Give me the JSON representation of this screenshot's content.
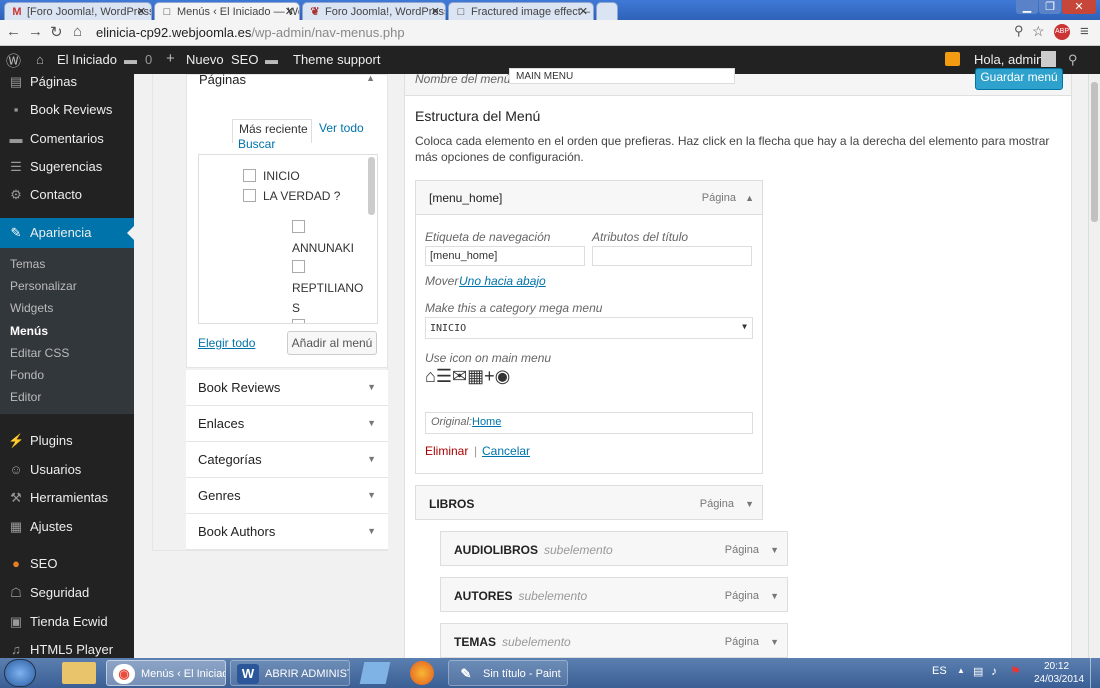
{
  "browser": {
    "tabs": [
      {
        "icon": "M",
        "title": "[Foro Joomla!, WordPress"
      },
      {
        "icon": "□",
        "title": "Menús ‹ El Iniciado — Wo"
      },
      {
        "icon": "❦",
        "title": "Foro Joomla!, WordPress y"
      },
      {
        "icon": "□",
        "title": "Fractured image effect – F"
      }
    ],
    "url_host": "elinicia-cp92.webjoomla.es",
    "url_path": "/wp-admin/nav-menus.php"
  },
  "adminbar": {
    "site": "El Iniciado",
    "comments": "0",
    "new": "Nuevo",
    "seo": "SEO",
    "theme_support": "Theme support",
    "greeting": "Hola, admin"
  },
  "sidebar": {
    "items": [
      {
        "icon": "▤",
        "label": "Páginas"
      },
      {
        "icon": "▪",
        "label": "Book Reviews"
      },
      {
        "icon": "▬",
        "label": "Comentarios"
      },
      {
        "icon": "☰",
        "label": "Sugerencias"
      },
      {
        "icon": "⚙",
        "label": "Contacto"
      },
      {
        "icon": "✎",
        "label": "Apariencia"
      },
      {
        "icon": "⚡",
        "label": "Plugins"
      },
      {
        "icon": "☺",
        "label": "Usuarios"
      },
      {
        "icon": "⚒",
        "label": "Herramientas"
      },
      {
        "icon": "▦",
        "label": "Ajustes"
      },
      {
        "icon": "●",
        "label": "SEO"
      },
      {
        "icon": "☖",
        "label": "Seguridad"
      },
      {
        "icon": "▣",
        "label": "Tienda Ecwid"
      },
      {
        "icon": "♫",
        "label": "HTML5 Player"
      }
    ],
    "submenu": [
      "Temas",
      "Personalizar",
      "Widgets",
      "Menús",
      "Editar CSS",
      "Fondo",
      "Editor"
    ]
  },
  "left_panel": {
    "pages_title": "Páginas",
    "tab_recent": "Más reciente",
    "tab_all": "Ver todo",
    "tab_search": "Buscar",
    "pages": [
      "INICIO",
      "LA VERDAD ?",
      "ANNUNAKI",
      "REPTILIANO",
      "S"
    ],
    "select_all": "Elegir todo",
    "add_button": "Añadir al menú",
    "sections": [
      "Book Reviews",
      "Enlaces",
      "Categorías",
      "Genres",
      "Book Authors"
    ]
  },
  "menu": {
    "name_label": "Nombre del menú",
    "name_value": "MAIN MENU",
    "save_button": "Guardar menú",
    "structure_title": "Estructura del Menú",
    "instructions": "Coloca cada elemento en el orden que prefieras. Haz click en la flecha que hay a la derecha del elemento para mostrar más opciones de configuración.",
    "open_item": {
      "title": "[menu_home]",
      "type": "Página",
      "nav_label_label": "Etiqueta de navegación",
      "nav_label_value": "[menu_home]",
      "title_attr_label": "Atributos del título",
      "title_attr_value": "",
      "move_label": "Mover",
      "move_link": "Uno hacia abajo",
      "mega_label": "Make this a category mega menu",
      "mega_value": "INICIO",
      "icon_label": "Use icon on main menu",
      "original_label": "Original:",
      "original_link": "Home",
      "delete": "Eliminar",
      "cancel": "Cancelar"
    },
    "items": [
      {
        "title": "LIBROS",
        "sub": "",
        "type": "Página"
      },
      {
        "title": "AUDIOLIBROS",
        "sub": "subelemento",
        "type": "Página"
      },
      {
        "title": "AUTORES",
        "sub": "subelemento",
        "type": "Página"
      },
      {
        "title": "TEMAS",
        "sub": "subelemento",
        "type": "Página"
      }
    ]
  },
  "taskbar": {
    "items": [
      {
        "icon": "◉",
        "label": "Menús ‹ El Iniciad..."
      },
      {
        "icon": "W",
        "label": "ABRIR ADMINIST..."
      },
      {
        "icon": "✎",
        "label": "Sin título - Paint"
      }
    ],
    "lang": "ES",
    "time": "20:12",
    "date": "24/03/2014"
  },
  "colors": {
    "wp_blue": "#0073aa",
    "active_menu": "#0073aa",
    "adminbar": "#222222"
  }
}
